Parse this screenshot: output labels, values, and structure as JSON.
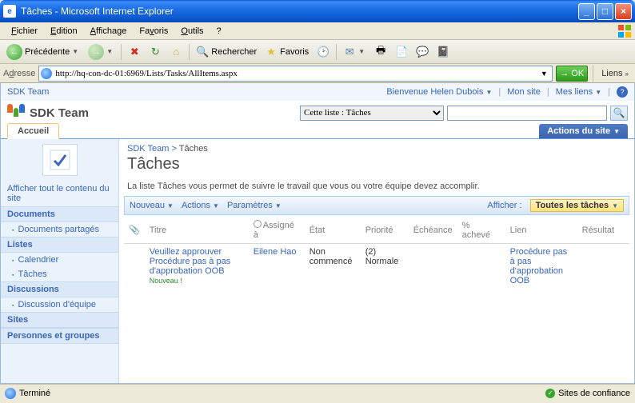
{
  "window": {
    "title": "Tâches - Microsoft Internet Explorer"
  },
  "menu": {
    "fichier": "Fichier",
    "edition": "Edition",
    "affichage": "Affichage",
    "favoris": "Favoris",
    "outils": "Outils",
    "aide": "?"
  },
  "toolbar": {
    "back": "Précédente",
    "search": "Rechercher",
    "favorites": "Favoris"
  },
  "address": {
    "label": "Adresse",
    "url": "http://hq-con-dc-01:6969/Lists/Tasks/AllItems.aspx",
    "go": "OK",
    "links": "Liens"
  },
  "topnav": {
    "site": "SDK Team",
    "welcome": "Bienvenue Helen Dubois",
    "mysite": "Mon site",
    "mylinks": "Mes liens"
  },
  "siteheader": {
    "title": "SDK Team",
    "scope_selected": "Cette liste : Tâches"
  },
  "tabs": {
    "home": "Accueil",
    "siteactions": "Actions du site"
  },
  "quicklaunch": {
    "viewall": "Afficher tout le contenu du site",
    "heads": {
      "documents": "Documents",
      "lists": "Listes",
      "discussions": "Discussions",
      "sites": "Sites",
      "people": "Personnes et groupes"
    },
    "items": {
      "shareddocs": "Documents partagés",
      "calendar": "Calendrier",
      "tasks": "Tâches",
      "teamdisc": "Discussion d'équipe"
    }
  },
  "breadcrumb": {
    "root": "SDK Team",
    "sep": ">",
    "current": "Tâches"
  },
  "page": {
    "title": "Tâches",
    "desc": "La liste Tâches vous permet de suivre le travail que vous ou votre équipe devez accomplir."
  },
  "listtoolbar": {
    "new": "Nouveau",
    "actions": "Actions",
    "settings": "Paramètres",
    "showlabel": "Afficher :",
    "view": "Toutes les tâches"
  },
  "columns": {
    "attach": "📎",
    "title": "Titre",
    "assigned": "Assigné à",
    "status": "État",
    "priority": "Priorité",
    "due": "Échéance",
    "pct": "% achevé",
    "link": "Lien",
    "result": "Résultat"
  },
  "rows": [
    {
      "title": "Veuillez approuver Procédure pas à pas d'approbation OOB",
      "newbadge": "Nouveau !",
      "assigned": "Eilene Hao",
      "status": "Non commencé",
      "priority": "(2) Normale",
      "due": "",
      "pct": "",
      "link": "Procédure pas à pas d'approbation OOB",
      "result": ""
    }
  ],
  "status": {
    "done": "Terminé",
    "trust": "Sites de confiance"
  }
}
